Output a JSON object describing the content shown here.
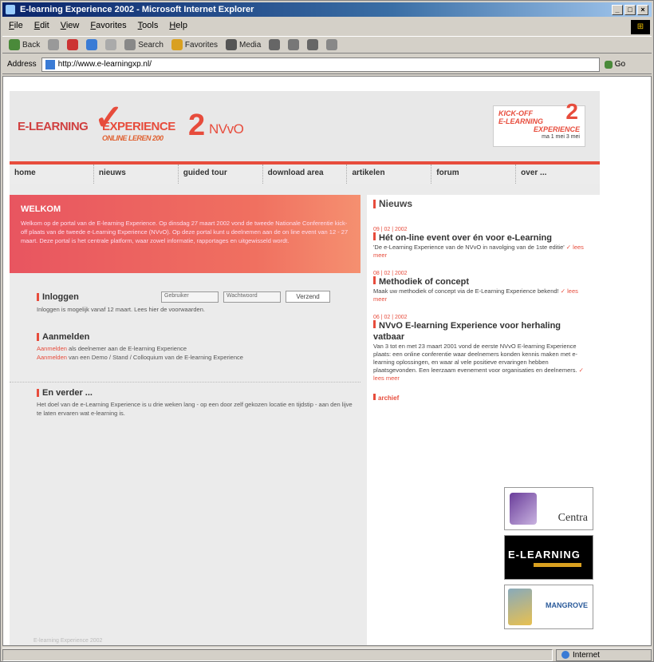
{
  "window": {
    "title": "E-learning Experience 2002 - Microsoft Internet Explorer",
    "min": "_",
    "max": "□",
    "close": "×",
    "brand": "⊞"
  },
  "menu": [
    "File",
    "Edit",
    "View",
    "Favorites",
    "Tools",
    "Help"
  ],
  "toolbar": {
    "back": "Back",
    "forward": "→",
    "search": "Search",
    "favorites": "Favorites",
    "media": "Media"
  },
  "address": {
    "label": "Address",
    "url": "http://www.e-learningxp.nl/",
    "go": "Go"
  },
  "site": {
    "logo": {
      "line1": "E-LEARNING",
      "check": "✓",
      "line2": "EXPERIENCE",
      "sub": "ONLINE LEREN 200",
      "two": "2",
      "org": "NVvO"
    },
    "kickoff": {
      "line1": "KICK-OFF",
      "line2": "E-LEARNING",
      "line3": "EXPERIENCE",
      "num": "2",
      "date": "ma 1 mei 3 mei"
    },
    "nav": [
      "home",
      "nieuws",
      "guided tour",
      "download area",
      "artikelen",
      "forum",
      "over ..."
    ],
    "welcome": {
      "title": "WELKOM",
      "text": "Welkom op de portal van de E-learning Experience. Op dinsdag 27 maart 2002 vond de tweede Nationale Conferentie kick-off plaats van de tweede e-Learning Experience (NVvO). Op deze portal kunt u deelnemen aan de on line event van 12 - 27 maart. Deze portal is het centrale platform, waar zowel informatie, rapportages en uitgewisseld wordt."
    },
    "login": {
      "title": "Inloggen",
      "user_ph": "Gebruiker",
      "pass_ph": "Wachtwoord",
      "button": "Verzend",
      "note": "Inloggen is mogelijk vanaf 12 maart. Lees hier de voorwaarden."
    },
    "register": {
      "title": "Aanmelden",
      "link1": "Aanmelden",
      "text1": "als deelnemer aan de E-learning Experience",
      "link2": "Aanmelden",
      "text2": "van een Demo / Stand / Colloquium van de E-learning Experience"
    },
    "further": {
      "title": "En verder ...",
      "text": "Het doel van de e-Learning Experience is u drie weken lang - op een door zelf gekozen locatie en tijdstip - aan den lijve te laten ervaren wat e-learning is."
    },
    "footnote": "E-learning Experience 2002",
    "news": {
      "title": "Nieuws",
      "items": [
        {
          "date": "09 | 02 | 2002",
          "title": "Hét on-line event over én voor e-Learning",
          "body": "'De e-Learning Experience van de NVvO in navolging van de 1ste editie'",
          "more": "lees meer"
        },
        {
          "date": "08 | 02 | 2002",
          "title": "Methodiek of concept",
          "body": "Maak uw methodiek of concept via de E-Learning Experience bekend!",
          "more": "lees meer"
        },
        {
          "date": "06 | 02 | 2002",
          "title": "NVvO E-learning Experience voor herhaling vatbaar",
          "body": "Van 3 tot en met 23 maart 2001 vond de eerste NVvO E-learning Experience plaats: een online conferentie waar deelnemers konden kennis maken met e-learning oplossingen, en waar al vele positieve ervaringen hebben plaatsgevonden. Een leerzaam evenement voor organisaties en deelnemers.",
          "more": "lees meer"
        }
      ],
      "archive": "archief"
    },
    "sponsors": {
      "s1": "Centra",
      "s2": "E-LEARNING",
      "s3": "MANGROVE"
    }
  },
  "status": {
    "zone": "Internet"
  }
}
